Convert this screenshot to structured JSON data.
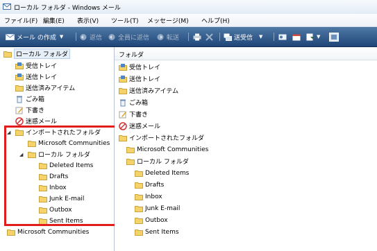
{
  "window": {
    "title": "ローカル フォルダ - Windows メール"
  },
  "menu": [
    "ファイル(F)",
    "編集(E)",
    "表示(V)",
    "ツール(T)",
    "メッセージ(M)",
    "ヘルプ(H)"
  ],
  "toolbar": {
    "create_mail": "メール の作成",
    "reply": "返信",
    "reply_all": "全員に返信",
    "forward": "転送",
    "send_receive": "送受信"
  },
  "left_tree": {
    "root": "ローカル フォルダ",
    "inbox": "受信トレイ",
    "outbox": "送信トレイ",
    "sent": "送信済みアイテム",
    "trash": "ごみ箱",
    "drafts": "下書き",
    "junk": "迷惑メール",
    "imported": "インポートされたフォルダ",
    "ms_communities": "Microsoft Communities",
    "local_folder": "ローカル フォルダ",
    "sub": [
      "Deleted Items",
      "Drafts",
      "Inbox",
      "Junk E-mail",
      "Outbox",
      "Sent Items"
    ],
    "ms_communities_bottom": "Microsoft Communities"
  },
  "right_pane": {
    "header": "フォルダ",
    "items": [
      "受信トレイ",
      "送信トレイ",
      "送信済みアイテム",
      "ごみ箱",
      "下書き",
      "迷惑メール",
      "インポートされたフォルダ",
      "Microsoft Communities",
      "ローカル フォルダ",
      "Deleted Items",
      "Drafts",
      "Inbox",
      "Junk E-mail",
      "Outbox",
      "Sent Items"
    ]
  },
  "colors": {
    "highlight": "#e21b1b",
    "toolbar": "#2b5585"
  }
}
